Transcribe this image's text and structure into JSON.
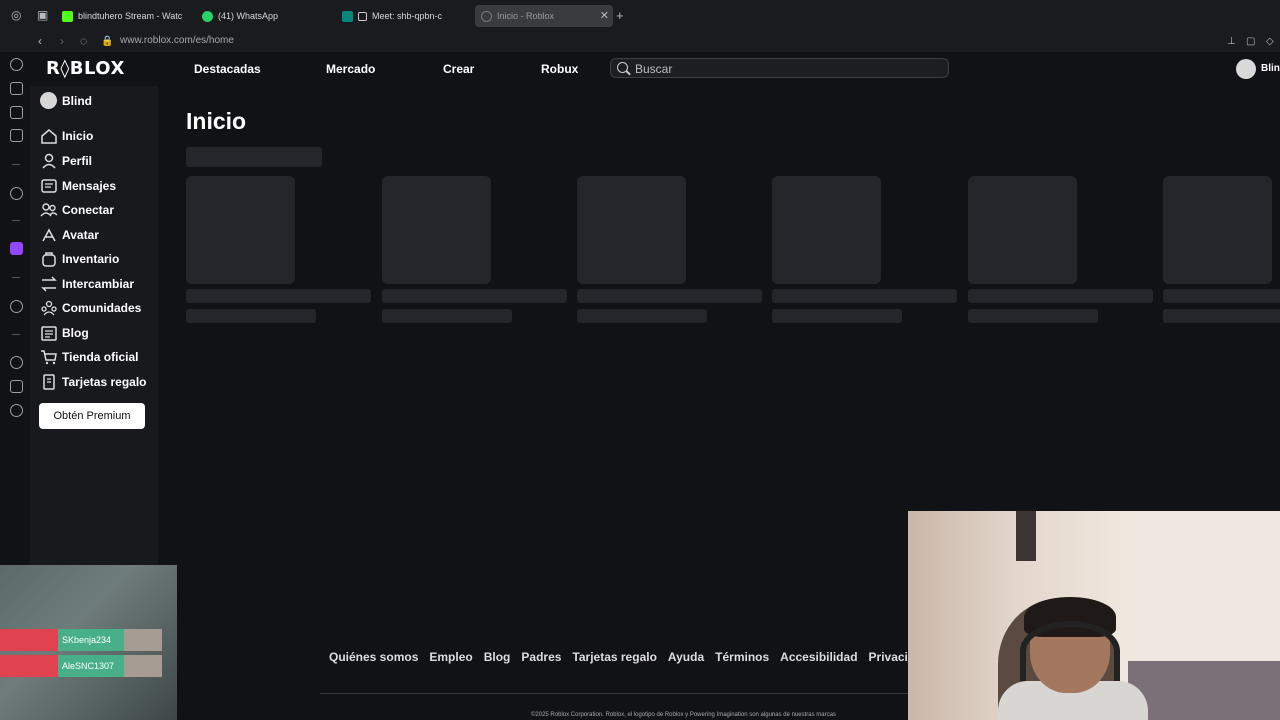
{
  "browser": {
    "tabs": [
      {
        "label": "blindtuhero Stream - Watc",
        "fav_color": "#53fc18"
      },
      {
        "label": "(41) WhatsApp",
        "fav_color": "#25d366"
      },
      {
        "label": "Meet: shb-qpbn-c",
        "fav_color": "#00897b"
      },
      {
        "label": "Inicio - Roblox",
        "fav_color": "#444444",
        "active": true
      }
    ],
    "new_tab": "+",
    "url": "www.roblox.com/es/home"
  },
  "header": {
    "logo": "R◊BLOX",
    "nav": [
      "Destacadas",
      "Mercado",
      "Crear",
      "Robux"
    ],
    "search_placeholder": "Buscar",
    "user_short": "Blind"
  },
  "sidebar": {
    "user": "Blind",
    "items": [
      {
        "label": "Inicio",
        "icon": "home-icon"
      },
      {
        "label": "Perfil",
        "icon": "profile-icon"
      },
      {
        "label": "Mensajes",
        "icon": "messages-icon"
      },
      {
        "label": "Conectar",
        "icon": "connect-icon"
      },
      {
        "label": "Avatar",
        "icon": "avatar-icon"
      },
      {
        "label": "Inventario",
        "icon": "inventory-icon"
      },
      {
        "label": "Intercambiar",
        "icon": "trade-icon"
      },
      {
        "label": "Comunidades",
        "icon": "communities-icon"
      },
      {
        "label": "Blog",
        "icon": "blog-icon"
      },
      {
        "label": "Tienda oficial",
        "icon": "store-icon"
      },
      {
        "label": "Tarjetas regalo",
        "icon": "gift-card-icon"
      }
    ],
    "premium": "Obtén Premium"
  },
  "main": {
    "title": "Inicio"
  },
  "footer": {
    "links": [
      "Quiénes somos",
      "Empleo",
      "Blog",
      "Padres",
      "Tarjetas regalo",
      "Ayuda",
      "Términos",
      "Accesibilidad",
      "Privacidad"
    ],
    "copyright": "©2025 Roblox Corporation. Roblox, el logotipo de Roblox y Powering Imagination son algunas de nuestras marcas"
  },
  "overlay": {
    "killfeed": [
      "SKbenja234",
      "AleSNC1307"
    ]
  }
}
